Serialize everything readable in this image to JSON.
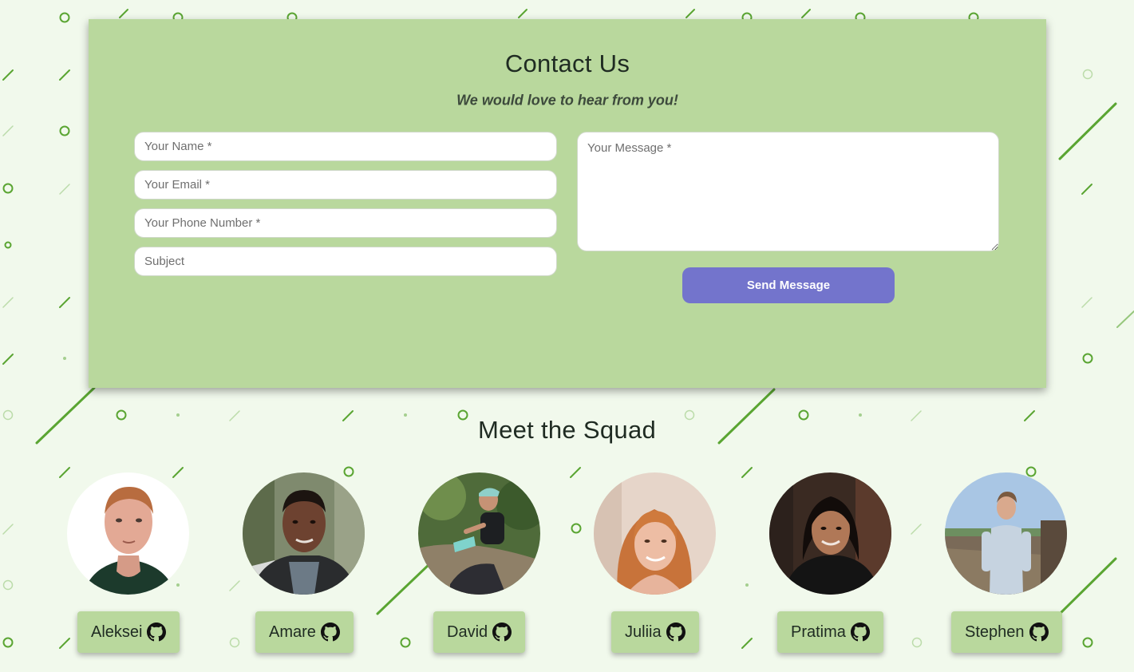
{
  "contact": {
    "title": "Contact Us",
    "subtitle": "We would love to hear from you!",
    "fields": {
      "name_placeholder": "Your Name *",
      "email_placeholder": "Your Email *",
      "phone_placeholder": "Your Phone Number *",
      "subject_placeholder": "Subject",
      "message_placeholder": "Your Message *"
    },
    "send_label": "Send Message"
  },
  "squad": {
    "title": "Meet the Squad",
    "members": [
      {
        "name": "Aleksei",
        "icon": "github-icon"
      },
      {
        "name": "Amare",
        "icon": "github-icon"
      },
      {
        "name": "David",
        "icon": "github-icon"
      },
      {
        "name": "Juliia",
        "icon": "github-icon"
      },
      {
        "name": "Pratima",
        "icon": "github-icon"
      },
      {
        "name": "Stephen",
        "icon": "github-icon"
      }
    ]
  },
  "colors": {
    "page_background": "#f1f9ec",
    "card_background": "#b9d89d",
    "accent_button": "#7374cc",
    "pattern_green": "#5aa532"
  }
}
